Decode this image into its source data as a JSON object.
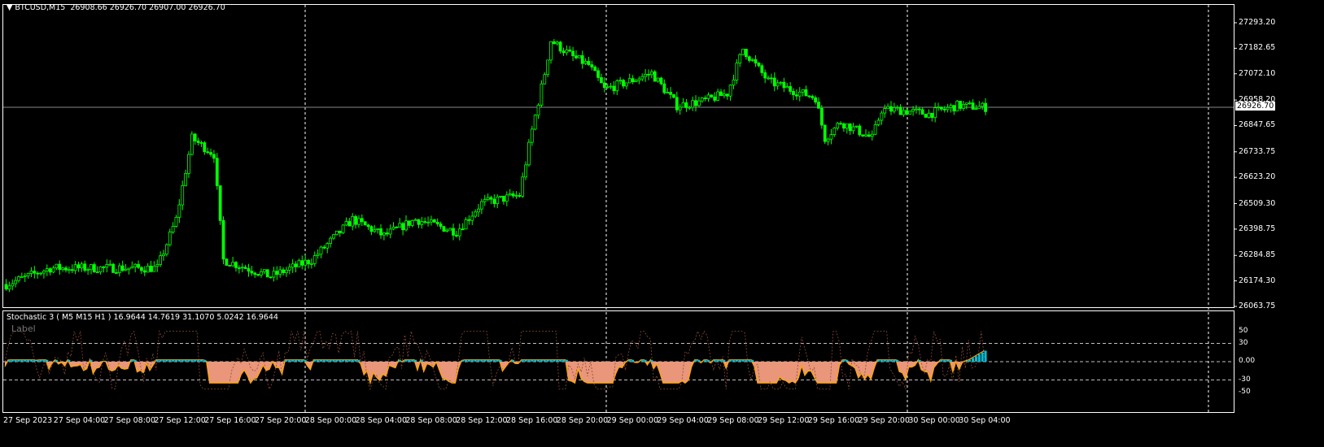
{
  "header": {
    "symbol": "BTCUSD,M15",
    "ohlc": "26908.66 26926.70 26907.00 26926.70"
  },
  "indicator": {
    "title": "Stochastic 3 ( M5  M15  H1 ) 16.9644 14.7619 31.1070 5.0242 16.9644",
    "label": "Label",
    "levels": [
      "50",
      "30",
      "0.00",
      "-30",
      "-50"
    ]
  },
  "price_axis": [
    "27293.20",
    "27182.65",
    "27072.10",
    "26958.20",
    "26847.65",
    "26733.75",
    "26623.20",
    "26509.30",
    "26398.75",
    "26284.85",
    "26174.30",
    "26063.75"
  ],
  "current_price": "26926.70",
  "time_axis": [
    "27 Sep 2023",
    "27 Sep 04:00",
    "27 Sep 08:00",
    "27 Sep 12:00",
    "27 Sep 16:00",
    "27 Sep 20:00",
    "28 Sep 00:00",
    "28 Sep 04:00",
    "28 Sep 08:00",
    "28 Sep 12:00",
    "28 Sep 16:00",
    "28 Sep 20:00",
    "29 Sep 00:00",
    "29 Sep 04:00",
    "29 Sep 08:00",
    "29 Sep 12:00",
    "29 Sep 16:00",
    "29 Sep 20:00",
    "30 Sep 00:00",
    "30 Sep 04:00"
  ],
  "colors": {
    "candle": "#00ff00",
    "grid": "#ffffff",
    "fill": "#e9967a",
    "line": "#ffa500",
    "cyan": "#00bcd4"
  },
  "chart_data": {
    "type": "candlestick",
    "ylim": [
      26063.75,
      27293.2
    ],
    "bars": 312,
    "price_keypoints": [
      [
        0,
        26159
      ],
      [
        14,
        26230
      ],
      [
        48,
        26230
      ],
      [
        54,
        26441
      ],
      [
        59,
        26793
      ],
      [
        66,
        26723
      ],
      [
        69,
        26265
      ],
      [
        84,
        26194
      ],
      [
        97,
        26265
      ],
      [
        110,
        26441
      ],
      [
        120,
        26370
      ],
      [
        130,
        26441
      ],
      [
        143,
        26388
      ],
      [
        151,
        26511
      ],
      [
        163,
        26546
      ],
      [
        167,
        26828
      ],
      [
        171,
        27075
      ],
      [
        173,
        27216
      ],
      [
        180,
        27145
      ],
      [
        185,
        27110
      ],
      [
        190,
        27004
      ],
      [
        198,
        27040
      ],
      [
        205,
        27075
      ],
      [
        213,
        26934
      ],
      [
        221,
        26952
      ],
      [
        229,
        26987
      ],
      [
        234,
        27180
      ],
      [
        242,
        27040
      ],
      [
        249,
        27004
      ],
      [
        257,
        26969
      ],
      [
        260,
        26793
      ],
      [
        265,
        26863
      ],
      [
        275,
        26793
      ],
      [
        278,
        26916
      ],
      [
        283,
        26916
      ],
      [
        293,
        26898
      ],
      [
        302,
        26934
      ],
      [
        311,
        26926.7
      ]
    ]
  }
}
